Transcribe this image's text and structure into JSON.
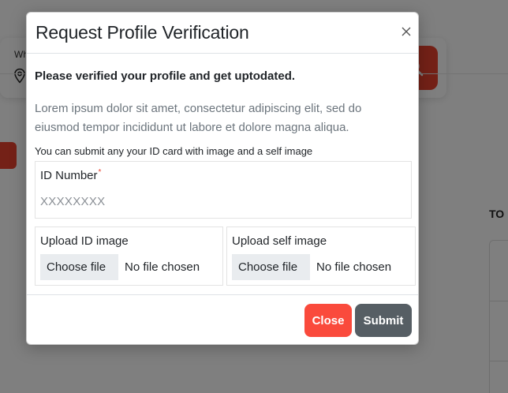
{
  "background": {
    "search_label": "Wh",
    "side_title": "TO"
  },
  "modal": {
    "title": "Request Profile Verification",
    "subtitle": "Please verified your profile and get uptodated.",
    "description": "Lorem ipsum dolor sit amet, consectetur adipiscing elit, sed do eiusmod tempor incididunt ut labore et dolore magna aliqua.",
    "hint": "You can submit any your ID card with image and a self image",
    "id_field": {
      "label": "ID Number",
      "required_marker": "*",
      "placeholder": "XXXXXXXX"
    },
    "upload_id": {
      "label": "Upload ID image",
      "button_label": "Choose file",
      "status": "No file chosen"
    },
    "upload_self": {
      "label": "Upload self image",
      "button_label": "Choose file",
      "status": "No file chosen"
    },
    "footer": {
      "close_label": "Close",
      "submit_label": "Submit"
    }
  },
  "icons": {
    "close": "close-icon",
    "location": "location-pin-icon",
    "search": "search-icon"
  },
  "colors": {
    "accent": "#fa4a3c",
    "submit": "#565e64",
    "overlay": "rgba(0,0,0,0.5)"
  }
}
